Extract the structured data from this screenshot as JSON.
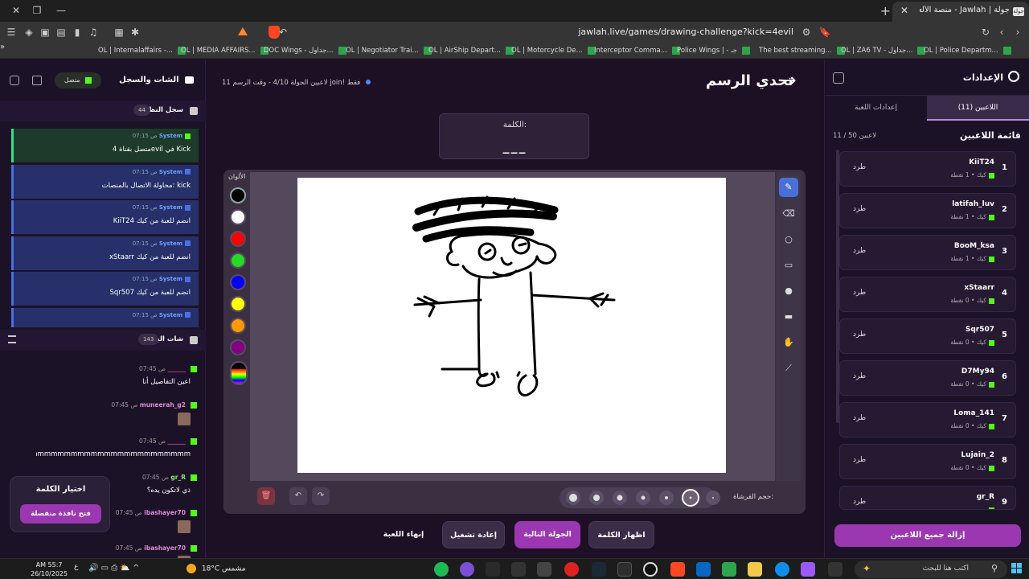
{
  "browser": {
    "tab_title": "جولة | Jawlah - منصة الألعاب التفا",
    "url": "jawlah.live/games/drawing-challenge?kick=4evil",
    "bookmarks": [
      "OL | Internalaffairs -...",
      "OL | MEDIA AFFAIRS...",
      "DOC Wings - جداول...",
      "OL | Negotiator Trai...",
      "OL | AirShip Depart...",
      "OL | Motorcycle De...",
      "Interceptor Comma...",
      "Police Wings | - جـ",
      "The best streaming...",
      "OL | ZA6 TV - جداول...",
      "OL | Police Departm..."
    ]
  },
  "settings_panel": {
    "title": "الإعدادات",
    "tabs": [
      "اللاعبين (11)",
      "إعدادات اللعبة"
    ],
    "list_title": "قائمة اللاعبين",
    "count": "11 / 50 لاعبين",
    "kick_label": "طرد",
    "players": [
      {
        "num": "1",
        "name": "KiiT24",
        "meta": "كيك • 1 نقطة"
      },
      {
        "num": "2",
        "name": "latifah_luv",
        "meta": "كيك • 1 نقطة"
      },
      {
        "num": "3",
        "name": "BooM_ksa",
        "meta": "كيك • 1 نقطة"
      },
      {
        "num": "4",
        "name": "xStaarr",
        "meta": "كيك • 0 نقطة"
      },
      {
        "num": "5",
        "name": "Sqr507",
        "meta": "كيك • 0 نقطة"
      },
      {
        "num": "6",
        "name": "D7My94",
        "meta": "كيك • 0 نقطة"
      },
      {
        "num": "7",
        "name": "Loma_141",
        "meta": "كيك • 0 نقطة"
      },
      {
        "num": "8",
        "name": "Lujain_2",
        "meta": "كيك • 0 نقطة"
      },
      {
        "num": "9",
        "name": "gr_R",
        "meta": ""
      }
    ],
    "remove_all": "إزالة جميع اللاعبين"
  },
  "game": {
    "title": "تحدي الرسم",
    "round_info": "11 لاعبين   الجولة 4/10 - وقت الرسم   join! فقط",
    "word_label": "الكلمة:",
    "word_blanks": "___",
    "colors_label": "الألوان",
    "colors": [
      "#000000",
      "#ffffff",
      "#ff0000",
      "#22dd22",
      "#0000ff",
      "#ffff00",
      "#ff9900",
      "#800080"
    ],
    "brush_label": "حجم الفرشاة:",
    "actions": [
      "اظهار الكلمة",
      "الجولة التالية",
      "إعادة تشغيل",
      "إنهاء اللعبة"
    ]
  },
  "chat_panel": {
    "title": "الشات والسجل",
    "status": "متصل",
    "system_log_title": "سجل النظام",
    "system_log_count": "44",
    "system_items": [
      {
        "who": "System",
        "time": "07:15 ص",
        "text": "متصل بقناة 4evil في Kick",
        "ok": true
      },
      {
        "who": "System",
        "time": "07:15 ص",
        "text": "محاولة الاتصال بالمنصات: kick",
        "ok": false
      },
      {
        "who": "System",
        "time": "07:15 ص",
        "text": "KiiT24 انضم للعبة من كيك",
        "ok": false
      },
      {
        "who": "System",
        "time": "07:15 ص",
        "text": "xStaarr انضم للعبة من كيك",
        "ok": false
      },
      {
        "who": "System",
        "time": "07:15 ص",
        "text": "Sqr507 انضم للعبة من كيك",
        "ok": false
      },
      {
        "who": "System",
        "time": "07:15 ص",
        "text": "",
        "ok": false
      }
    ],
    "live_chat_title": "شات البث",
    "live_chat_count": "143",
    "messages": [
      {
        "user": "______",
        "time": "07:45 ص",
        "text": "اعين التفاصيل أنا",
        "color": "#d24fa6"
      },
      {
        "user": "muneerah_g2",
        "time": "07:45 ص",
        "text": "",
        "color": "#e08ad4"
      },
      {
        "user": "______",
        "time": "07:45 ص",
        "text": "mmmmmmmmmmmmmmmmmmmmmmmm",
        "color": "#d24fa6"
      },
      {
        "user": "gr_R",
        "time": "07:45 ص",
        "text": "ذي لاتكون يده؟",
        "color": "#8be36b"
      },
      {
        "user": "ibashayer70",
        "time": "07:45 ص",
        "text": "",
        "color": "#e08ad4"
      },
      {
        "user": "ibashayer70",
        "time": "07:45 ص",
        "text": "",
        "color": "#e08ad4"
      }
    ],
    "pick_title": "اختيار الكلمة",
    "pick_button": "فتح نافذة منفصلة"
  },
  "taskbar": {
    "time": "AM 55:7",
    "date": "26/10/2025",
    "weather": "18°C مشمس",
    "search_placeholder": "اكتب هنا للبحث"
  }
}
